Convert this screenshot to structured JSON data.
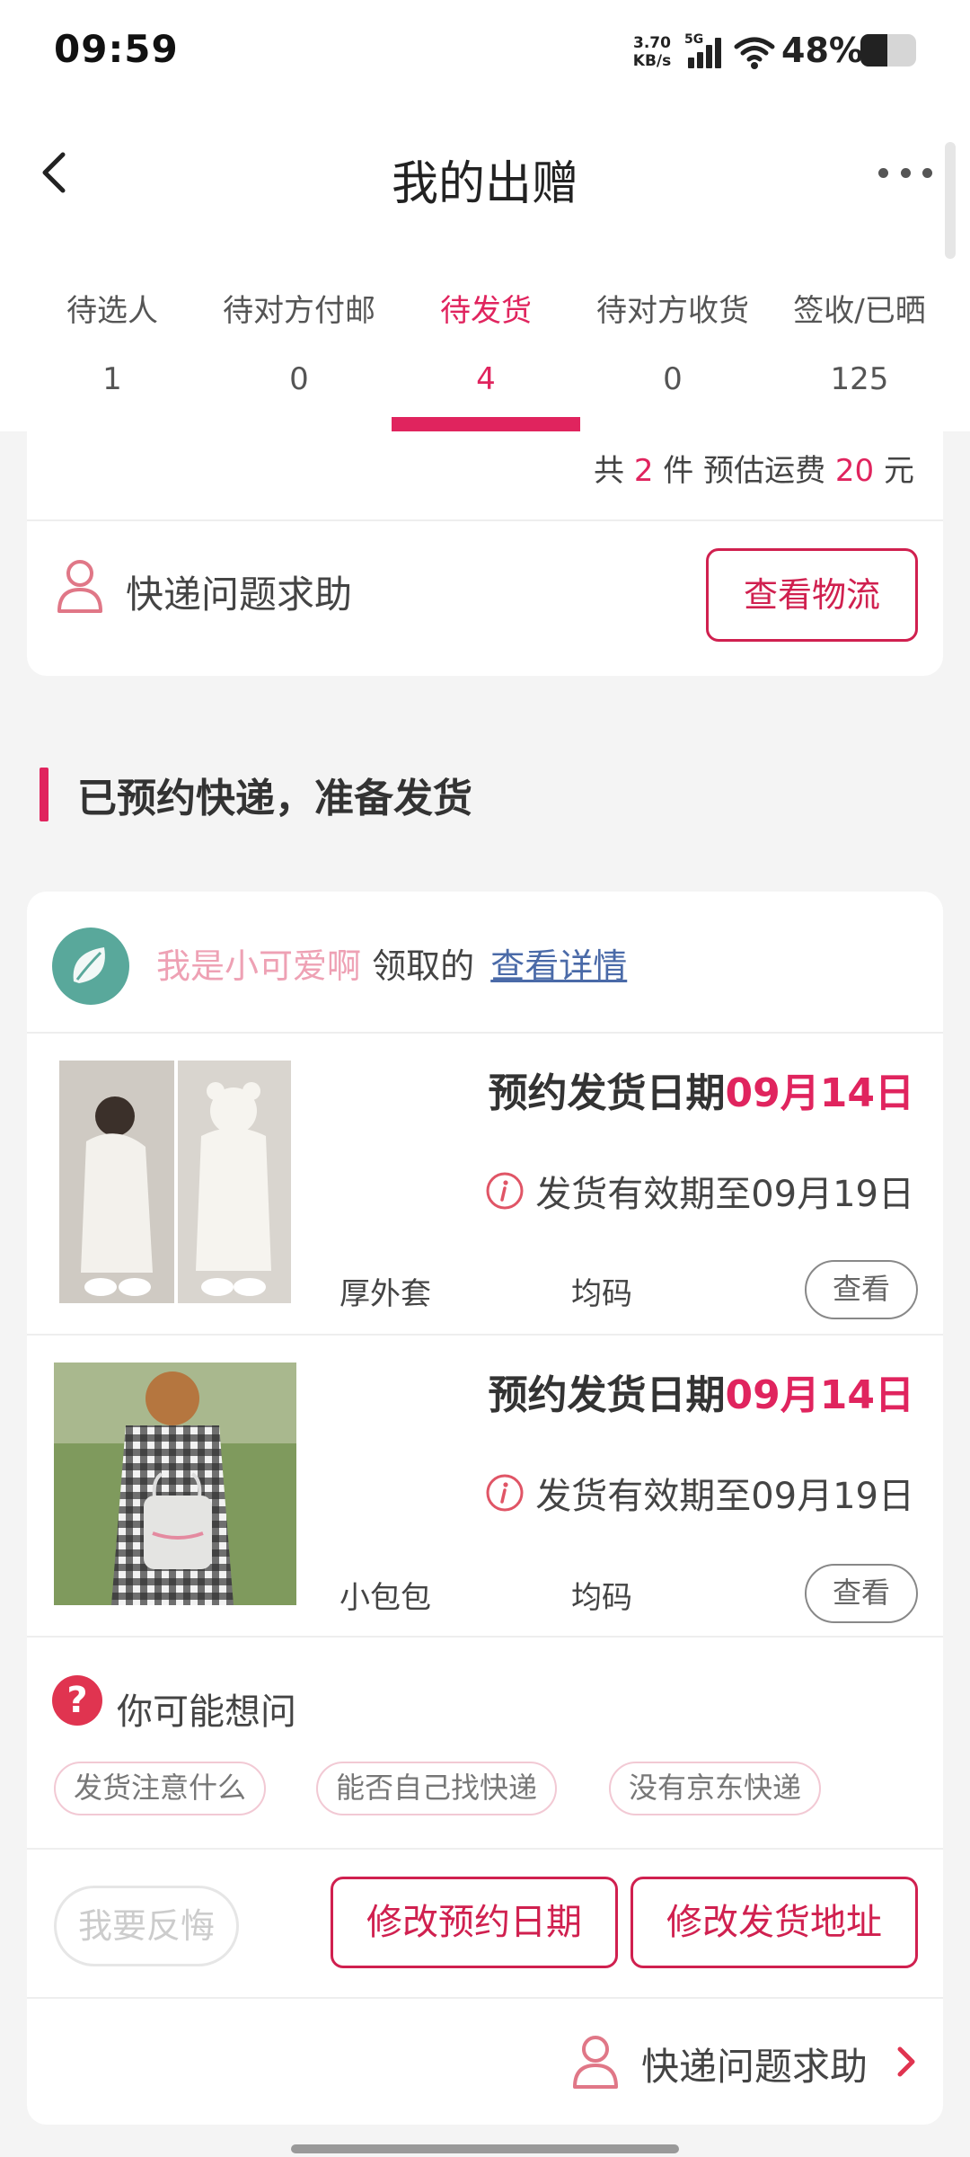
{
  "status_bar": {
    "time": "09:59",
    "net_speed_value": "3.70",
    "net_speed_unit": "KB/s",
    "network_type": "5G",
    "battery_percent": "48%",
    "battery_level": 0.48
  },
  "header": {
    "title": "我的出赠"
  },
  "tabs": [
    {
      "label": "待选人",
      "count": "1"
    },
    {
      "label": "待对方付邮",
      "count": "0"
    },
    {
      "label": "待发货",
      "count": "4",
      "active": true
    },
    {
      "label": "待对方收货",
      "count": "0"
    },
    {
      "label": "签收/已晒",
      "count": "125"
    }
  ],
  "top_card": {
    "summary_prefix": "共",
    "summary_count": "2",
    "summary_mid": "件 预估运费",
    "summary_fee": "20",
    "summary_suffix": "元",
    "help_label": "快递问题求助",
    "track_button": "查看物流"
  },
  "section": {
    "title": "已预约快递，准备发货"
  },
  "order": {
    "user_name": "我是小可爱啊",
    "claimed_text": "领取的",
    "details_link": "查看详情",
    "items": [
      {
        "date_prefix": "预约发货日期",
        "date": "09月14日",
        "valid_text": "发货有效期至09月19日",
        "name": "厚外套",
        "size": "均码",
        "view_button": "查看"
      },
      {
        "date_prefix": "预约发货日期",
        "date": "09月14日",
        "valid_text": "发货有效期至09月19日",
        "name": "小包包",
        "size": "均码",
        "view_button": "查看"
      }
    ],
    "faq_title": "你可能想问",
    "faq_chips": [
      "发货注意什么",
      "能否自己找快递",
      "没有京东快递"
    ],
    "regret_button": "我要反悔",
    "modify_date_button": "修改预约日期",
    "modify_address_button": "修改发货地址",
    "help_label": "快递问题求助"
  },
  "colors": {
    "accent": "#e0245e",
    "username": "#eea1b4",
    "link": "#4a6aa8",
    "avatar_bg": "#59a89b"
  }
}
